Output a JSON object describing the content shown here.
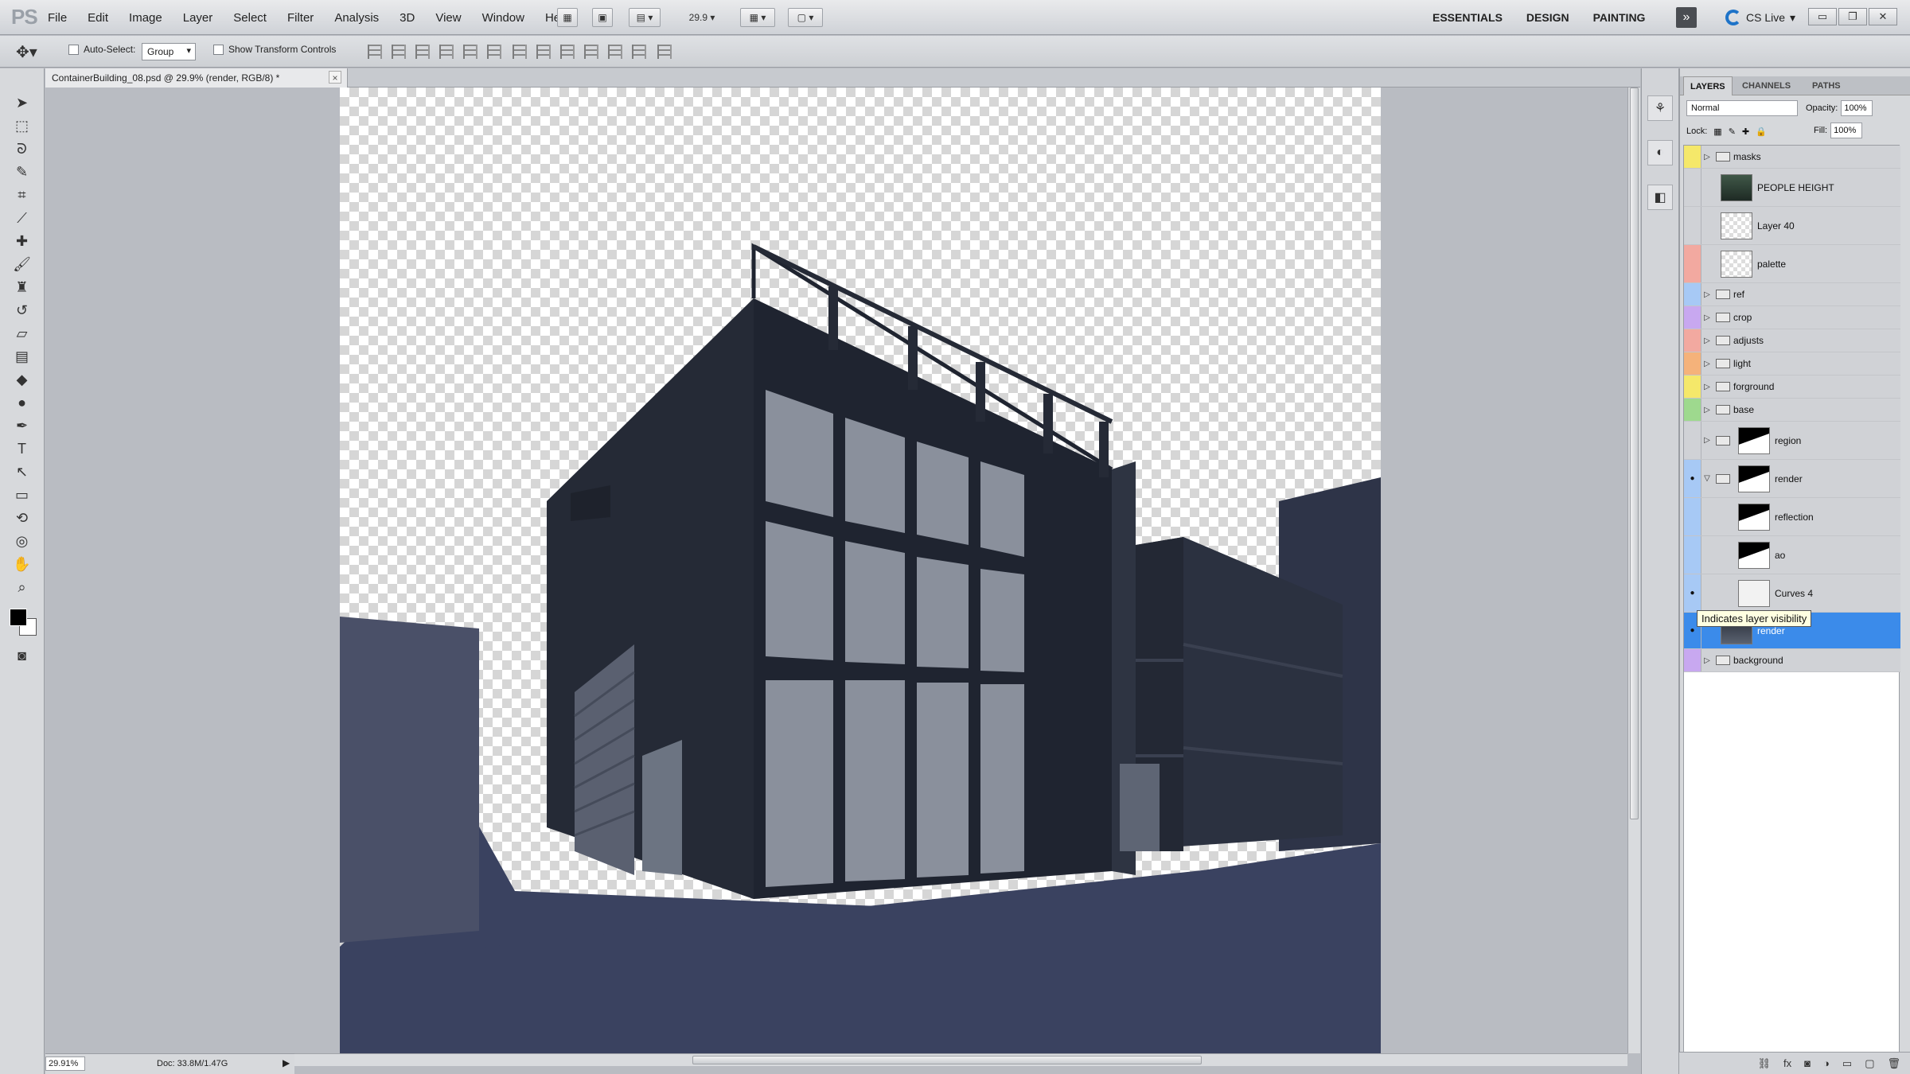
{
  "menubar": {
    "logo": "PS",
    "items": [
      "File",
      "Edit",
      "Image",
      "Layer",
      "Select",
      "Filter",
      "Analysis",
      "3D",
      "View",
      "Window",
      "Help"
    ],
    "zoom_value": "29.9",
    "workspaces": [
      "ESSENTIALS",
      "DESIGN",
      "PAINTING"
    ],
    "more": "»",
    "cslive": "CS Live"
  },
  "options": {
    "auto_select_label": "Auto-Select:",
    "auto_select_value": "Group",
    "transform_label": "Show Transform Controls"
  },
  "document": {
    "tab_title": "ContainerBuilding_08.psd @ 29.9% (render, RGB/8) *",
    "close": "×"
  },
  "status": {
    "zoom": "29.91%",
    "doc_size": "Doc: 33.8M/1.47G"
  },
  "layers_panel": {
    "tabs": [
      "LAYERS",
      "CHANNELS",
      "PATHS"
    ],
    "blend_mode": "Normal",
    "opacity_label": "Opacity:",
    "opacity_value": "100%",
    "lock_label": "Lock:",
    "fill_label": "Fill:",
    "fill_value": "100%",
    "tooltip": "Indicates layer visibility",
    "layers": [
      {
        "name": "masks",
        "kind": "group",
        "color": "#f5e86a",
        "visible": false
      },
      {
        "name": "PEOPLE HEIGHT",
        "kind": "layer",
        "color": "#d0d2d6",
        "visible": false
      },
      {
        "name": "Layer 40",
        "kind": "layer",
        "color": "#d0d2d6",
        "visible": false
      },
      {
        "name": "palette",
        "kind": "layer",
        "color": "#f2a9a0",
        "visible": false
      },
      {
        "name": "ref",
        "kind": "group",
        "color": "#a7c9f5",
        "visible": false
      },
      {
        "name": "crop",
        "kind": "group",
        "color": "#c8a8f0",
        "visible": false
      },
      {
        "name": "adjusts",
        "kind": "group",
        "color": "#f2a9a0",
        "visible": false
      },
      {
        "name": "light",
        "kind": "group",
        "color": "#f5b27a",
        "visible": false
      },
      {
        "name": "forground",
        "kind": "group",
        "color": "#f5e86a",
        "visible": false
      },
      {
        "name": "base",
        "kind": "group",
        "color": "#9ed98e",
        "visible": false
      },
      {
        "name": "region",
        "kind": "masked-group",
        "color": "#d0d2d6",
        "visible": false
      },
      {
        "name": "render",
        "kind": "masked-group",
        "color": "#a7c9f5",
        "visible": true
      },
      {
        "name": "reflection",
        "kind": "clipped",
        "color": "#a7c9f5",
        "visible": false
      },
      {
        "name": "ao",
        "kind": "clipped",
        "color": "#a7c9f5",
        "visible": false
      },
      {
        "name": "Curves 4",
        "kind": "adjustment",
        "color": "#a7c9f5",
        "visible": true
      },
      {
        "name": "render",
        "kind": "selected",
        "color": "#3b8bea",
        "visible": true
      },
      {
        "name": "background",
        "kind": "group",
        "color": "#c8a8f0",
        "visible": false
      }
    ]
  }
}
